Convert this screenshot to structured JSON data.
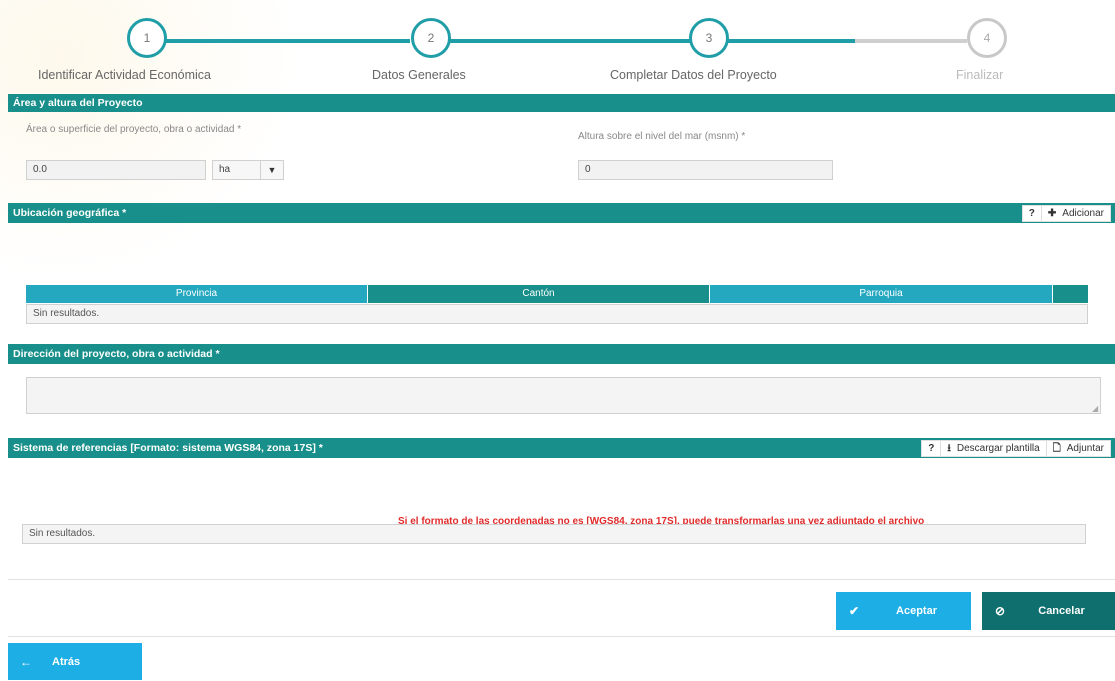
{
  "stepper": {
    "steps": [
      {
        "number": "1",
        "label": "Identificar Actividad Económica"
      },
      {
        "number": "2",
        "label": "Datos Generales"
      },
      {
        "number": "3",
        "label": "Completar Datos del Proyecto"
      },
      {
        "number": "4",
        "label": "Finalizar"
      }
    ],
    "current_step": 3
  },
  "area_section": {
    "title": "Área y altura del Proyecto",
    "area_label": "Área o superficie del proyecto, obra o actividad *",
    "area_value": "0.0",
    "unit_value": "ha",
    "altitude_label": "Altura sobre el nivel del mar (msnm) *",
    "altitude_value": "0"
  },
  "location_section": {
    "title": "Ubicación geográfica *",
    "help_label": "?",
    "add_label": "Adicionar",
    "columns": [
      "Provincia",
      "Cantón",
      "Parroquia"
    ],
    "empty_text": "Sin resultados."
  },
  "address_section": {
    "title": "Dirección del proyecto, obra o actividad *",
    "value": ""
  },
  "reference_section": {
    "title": "Sistema de referencias [Formato: sistema WGS84, zona 17S] *",
    "help_label": "?",
    "download_label": "Descargar plantilla",
    "attach_label": "Adjuntar",
    "warning": "Si el formato de las coordenadas no es [WGS84, zona 17S], puede transformarlas una vez adjuntado el archivo",
    "empty_text": "Sin resultados."
  },
  "actions": {
    "accept_label": "Aceptar",
    "cancel_label": "Cancelar",
    "back_label": "Atrás"
  },
  "colors": {
    "teal_dark": "#188f8a",
    "teal_light": "#23a8c0",
    "accept_blue": "#1eaee6",
    "cancel_dark": "#0e6f6e",
    "warning_red": "#e02b2b"
  },
  "icons": {
    "accept": "checkmark-icon",
    "cancel": "ban-icon",
    "back": "arrow-left-icon",
    "add": "plus-icon",
    "download": "download-icon",
    "attach": "file-icon"
  }
}
